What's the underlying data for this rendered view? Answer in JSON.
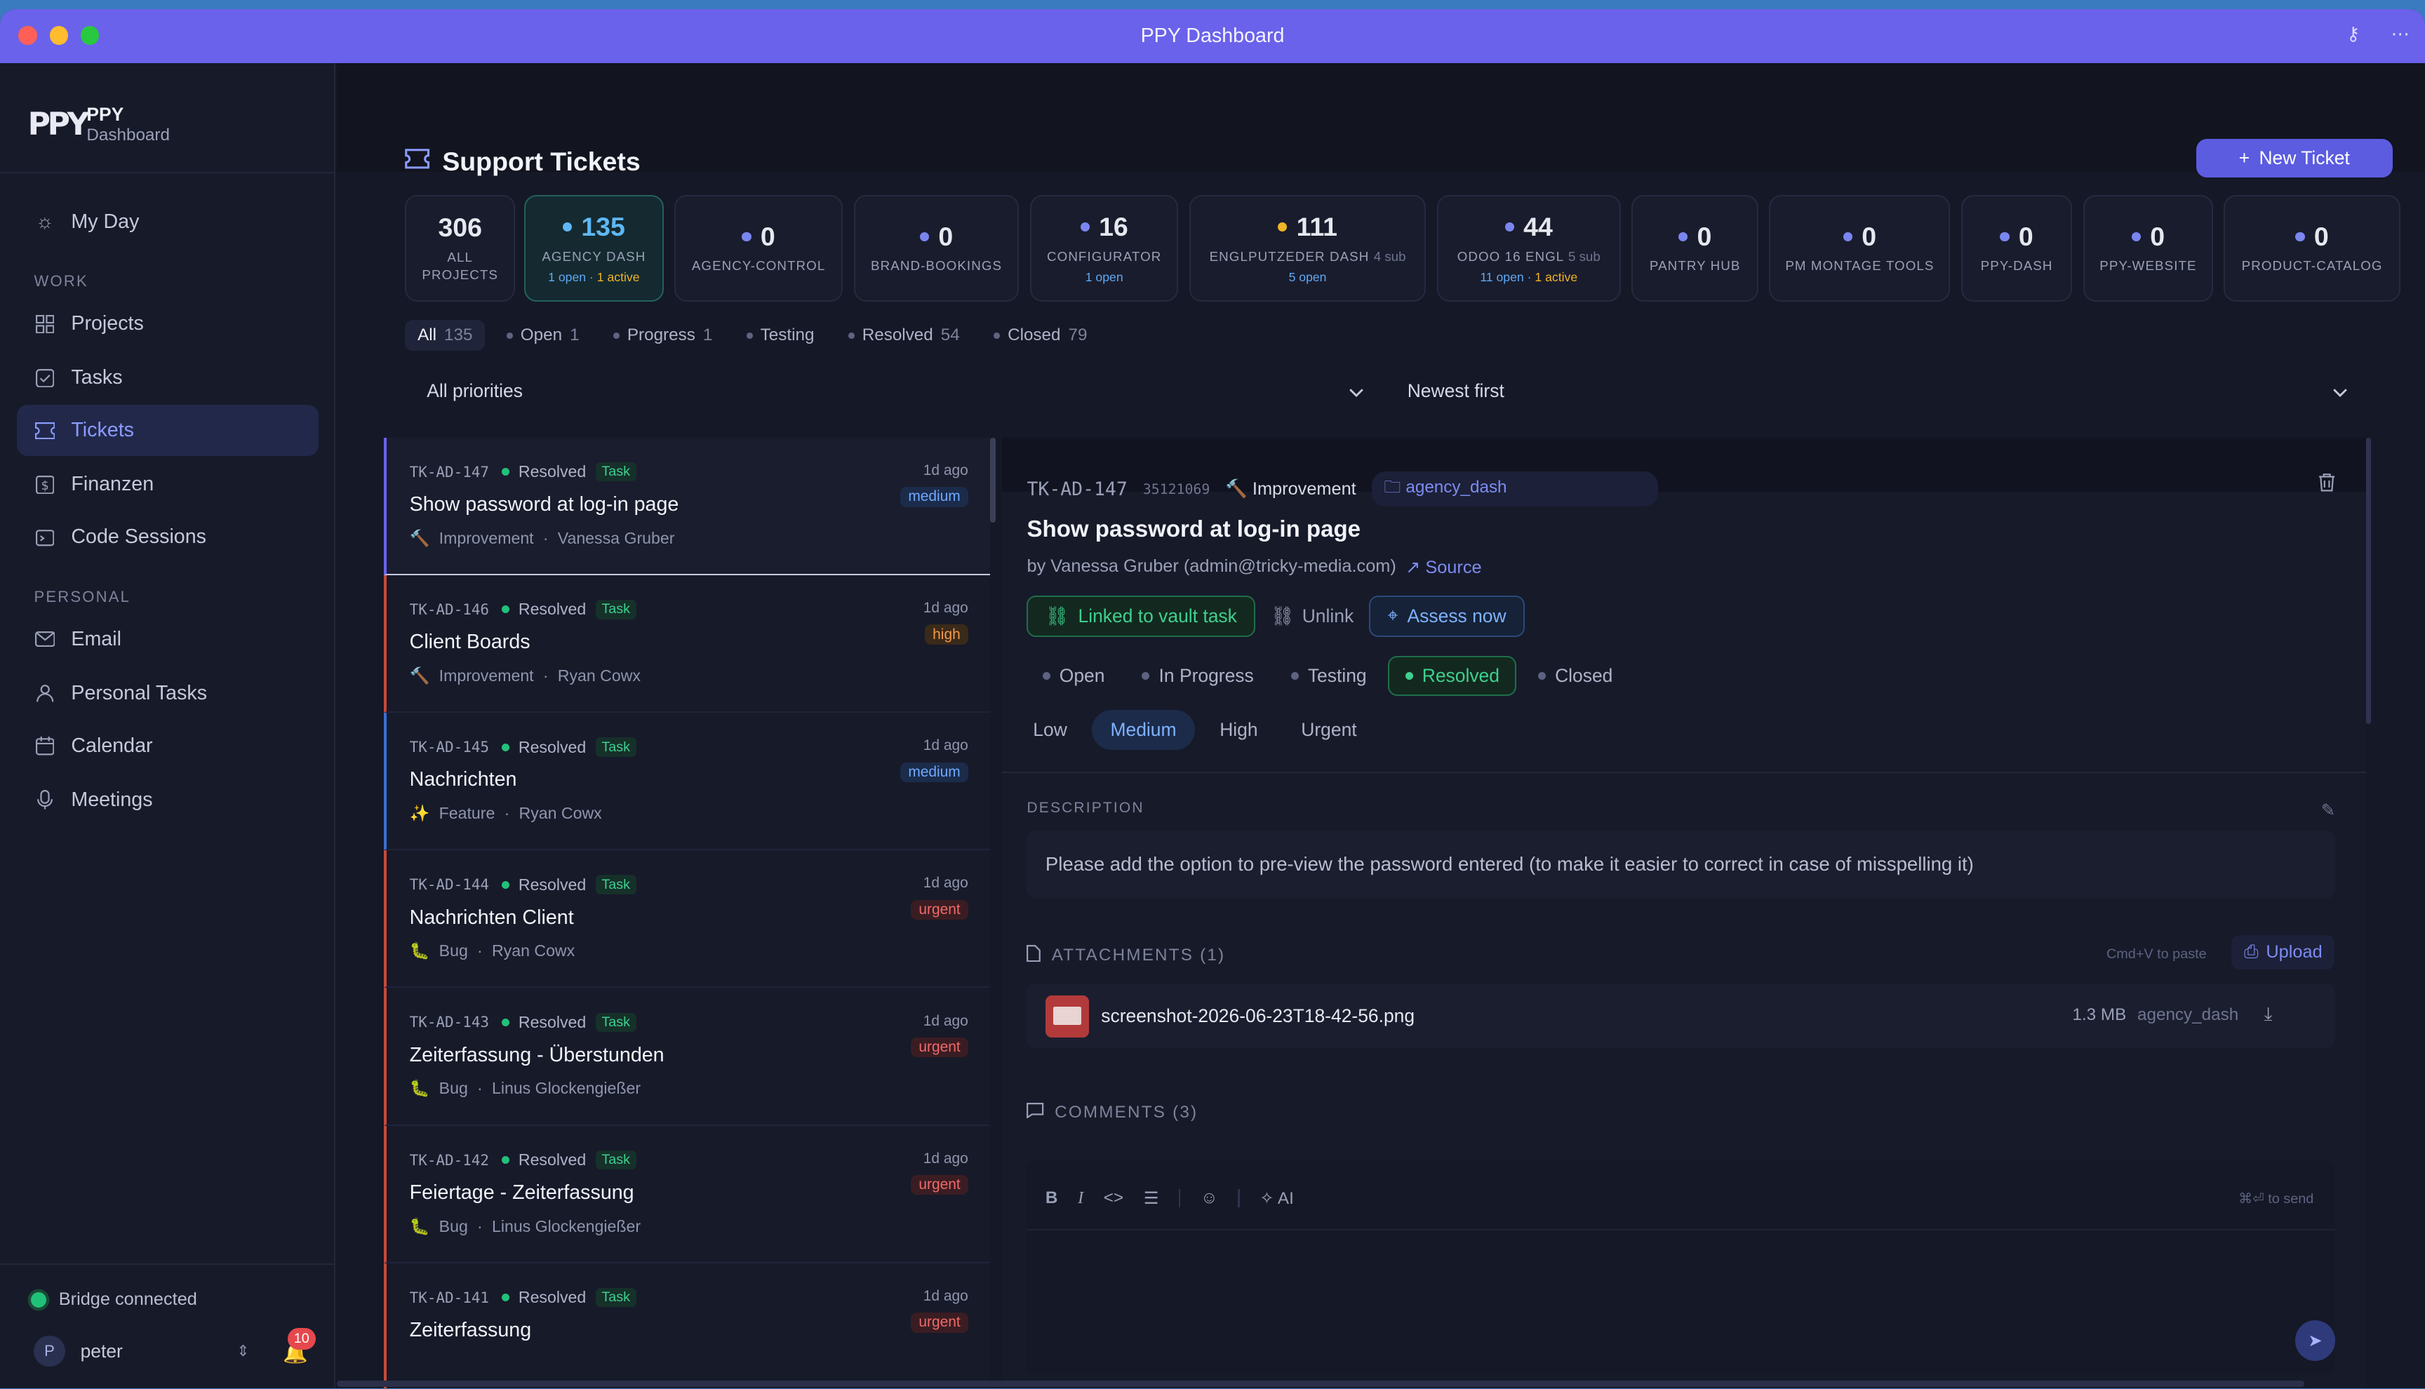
{
  "window": {
    "title": "PPY Dashboard"
  },
  "brand": {
    "logo": "PPY",
    "name": "PPY",
    "sub": "Dashboard"
  },
  "sidebar": {
    "myday": "My Day",
    "work_label": "WORK",
    "work": [
      {
        "label": "Projects",
        "icon": "grid-icon"
      },
      {
        "label": "Tasks",
        "icon": "checkbox-icon"
      },
      {
        "label": "Tickets",
        "icon": "ticket-icon"
      },
      {
        "label": "Finanzen",
        "icon": "dollar-icon"
      },
      {
        "label": "Code Sessions",
        "icon": "terminal-icon"
      }
    ],
    "personal_label": "PERSONAL",
    "personal": [
      {
        "label": "Email",
        "icon": "mail-icon"
      },
      {
        "label": "Personal Tasks",
        "icon": "user-icon"
      },
      {
        "label": "Calendar",
        "icon": "calendar-icon"
      },
      {
        "label": "Meetings",
        "icon": "mic-icon"
      }
    ],
    "bridge": "Bridge connected",
    "user_initial": "P",
    "user_name": "peter",
    "notifications": "10"
  },
  "page": {
    "title": "Support Tickets",
    "new_button": "New Ticket"
  },
  "cards": [
    {
      "num": "306",
      "label": "ALL",
      "label2": "PROJECTS"
    },
    {
      "num": "135",
      "label": "AGENCY DASH",
      "meta_open": "1 open",
      "meta_active": "1 active"
    },
    {
      "num": "0",
      "label": "AGENCY-CONTROL"
    },
    {
      "num": "0",
      "label": "BRAND-BOOKINGS"
    },
    {
      "num": "16",
      "label": "CONFIGURATOR",
      "meta_open": "1 open"
    },
    {
      "num": "111",
      "label": "ENGLPUTZEDER DASH",
      "sub": "4 sub",
      "meta_open": "5 open"
    },
    {
      "num": "44",
      "label": "ODOO 16 ENGL",
      "sub": "5 sub",
      "meta_open": "11 open",
      "meta_active": "1 active"
    },
    {
      "num": "0",
      "label": "PANTRY HUB"
    },
    {
      "num": "0",
      "label": "PM MONTAGE TOOLS"
    },
    {
      "num": "0",
      "label": "PPY-DASH"
    },
    {
      "num": "0",
      "label": "PPY-WEBSITE"
    },
    {
      "num": "0",
      "label": "PRODUCT-CATALOG"
    }
  ],
  "filters": [
    {
      "label": "All",
      "count": "135"
    },
    {
      "label": "Open",
      "count": "1"
    },
    {
      "label": "Progress",
      "count": "1"
    },
    {
      "label": "Testing",
      "count": ""
    },
    {
      "label": "Resolved",
      "count": "54"
    },
    {
      "label": "Closed",
      "count": "79"
    }
  ],
  "priority_select": "All priorities",
  "sort_select": "Newest first",
  "tickets": [
    {
      "id": "TK-AD-147",
      "status": "Resolved",
      "tag": "Task",
      "title": "Show password at log-in page",
      "type": "Improvement",
      "type_icon": "🔨",
      "author": "Vanessa Gruber",
      "ago": "1d ago",
      "priority": "medium"
    },
    {
      "id": "TK-AD-146",
      "status": "Resolved",
      "tag": "Task",
      "title": "Client Boards",
      "type": "Improvement",
      "type_icon": "🔨",
      "author": "Ryan Cowx",
      "ago": "1d ago",
      "priority": "high"
    },
    {
      "id": "TK-AD-145",
      "status": "Resolved",
      "tag": "Task",
      "title": "Nachrichten",
      "type": "Feature",
      "type_icon": "✨",
      "author": "Ryan Cowx",
      "ago": "1d ago",
      "priority": "medium"
    },
    {
      "id": "TK-AD-144",
      "status": "Resolved",
      "tag": "Task",
      "title": "Nachrichten Client",
      "type": "Bug",
      "type_icon": "🐛",
      "author": "Ryan Cowx",
      "ago": "1d ago",
      "priority": "urgent"
    },
    {
      "id": "TK-AD-143",
      "status": "Resolved",
      "tag": "Task",
      "title": "Zeiterfassung - Überstunden",
      "type": "Bug",
      "type_icon": "🐛",
      "author": "Linus Glockengießer",
      "ago": "1d ago",
      "priority": "urgent"
    },
    {
      "id": "TK-AD-142",
      "status": "Resolved",
      "tag": "Task",
      "title": "Feiertage - Zeiterfassung",
      "type": "Bug",
      "type_icon": "🐛",
      "author": "Linus Glockengießer",
      "ago": "1d ago",
      "priority": "urgent"
    },
    {
      "id": "TK-AD-141",
      "status": "Resolved",
      "tag": "Task",
      "title": "Zeiterfassung",
      "type": "",
      "type_icon": "",
      "author": "",
      "ago": "1d ago",
      "priority": "urgent"
    }
  ],
  "detail": {
    "id": "TK-AD-147",
    "hash": "35121069",
    "type": "Improvement",
    "project": "agency_dash",
    "title": "Show password at log-in page",
    "by": "by Vanessa Gruber (admin@tricky-media.com)",
    "source": "Source",
    "linked": "Linked to vault task",
    "unlink": "Unlink",
    "assess": "Assess now",
    "statuses": [
      "Open",
      "In Progress",
      "Testing",
      "Resolved",
      "Closed"
    ],
    "active_status": "Resolved",
    "priorities": [
      "Low",
      "Medium",
      "High",
      "Urgent"
    ],
    "active_priority": "Medium",
    "desc_label": "DESCRIPTION",
    "description": "Please add the option to pre-view the password entered (to make it easier to correct in case of misspelling it)",
    "att_label": "ATTACHMENTS (1)",
    "att_hint": "Cmd+V to paste",
    "upload": "Upload",
    "att_name": "screenshot-2026-06-23T18-42-56.png",
    "att_size": "1.3 MB",
    "att_proj": "agency_dash",
    "comments_label": "COMMENTS (3)",
    "ai_label": "AI",
    "send_hint": "⌘⏎ to send"
  },
  "colors": {
    "accent": "#6a62ea",
    "success": "#3fcf8e",
    "urgent": "#f06a6a",
    "high": "#f39a4a",
    "medium": "#6fa8ff"
  }
}
